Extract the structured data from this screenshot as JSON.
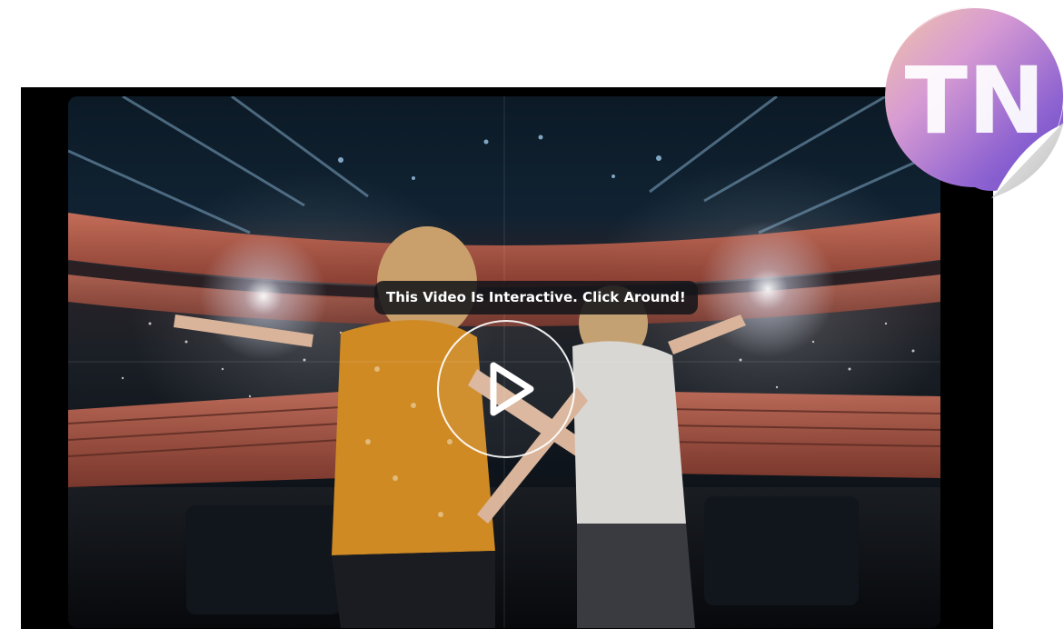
{
  "video": {
    "tooltip": "This Video Is Interactive. Click Around!",
    "play_icon": "play-icon"
  },
  "logo": {
    "text": "TN",
    "icon": "tn-sticker-logo"
  },
  "colors": {
    "player_bg": "#000000",
    "page_bg": "#ffffff",
    "seat_red": "#c7624c",
    "shirt_orange": "#d6902a",
    "logo_purple": "#8e5fd0",
    "logo_pink": "#e8a9cf"
  }
}
